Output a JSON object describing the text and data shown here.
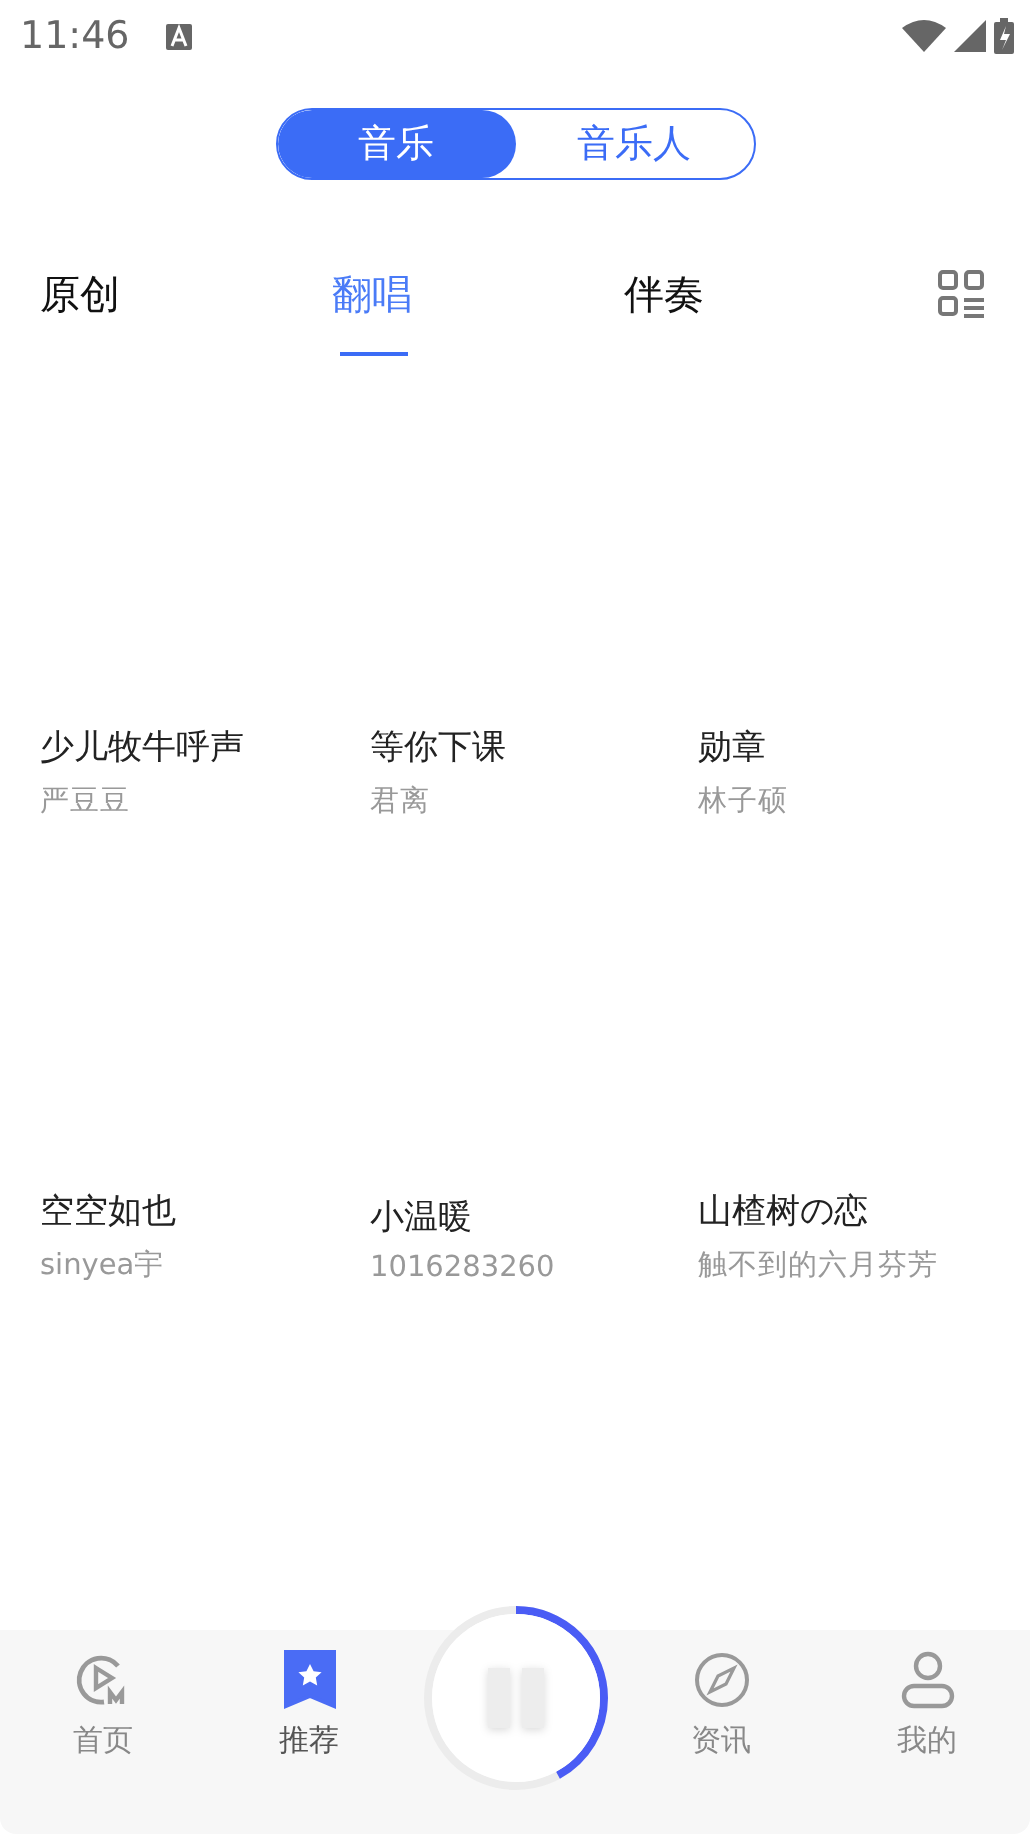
{
  "status_bar": {
    "time": "11:46"
  },
  "segment": [
    {
      "label": "音乐",
      "selected": true
    },
    {
      "label": "音乐人",
      "selected": false
    }
  ],
  "tabs": [
    {
      "label": "原创",
      "selected": false
    },
    {
      "label": "翻唱",
      "selected": true
    },
    {
      "label": "伴奏",
      "selected": false
    }
  ],
  "songs": [
    {
      "title": "少儿牧牛呼声",
      "artist": "严豆豆"
    },
    {
      "title": "等你下课",
      "artist": "君离"
    },
    {
      "title": "勋章",
      "artist": "林子硕"
    },
    {
      "title": "空空如也",
      "artist": "sinyea宇"
    },
    {
      "title": "小温暖",
      "artist": "1016283260"
    },
    {
      "title": "山楂树の恋",
      "artist": "触不到的六月芬芳"
    }
  ],
  "player": {
    "playing": true,
    "level": 0.42
  },
  "bottom_nav": [
    {
      "label": "首页",
      "kind": "home",
      "selected": false
    },
    {
      "label": "推荐",
      "kind": "recommend",
      "selected": true
    },
    {
      "kind": "player"
    },
    {
      "label": "资讯",
      "kind": "news",
      "selected": false
    },
    {
      "label": "我的",
      "kind": "me",
      "selected": false
    }
  ]
}
